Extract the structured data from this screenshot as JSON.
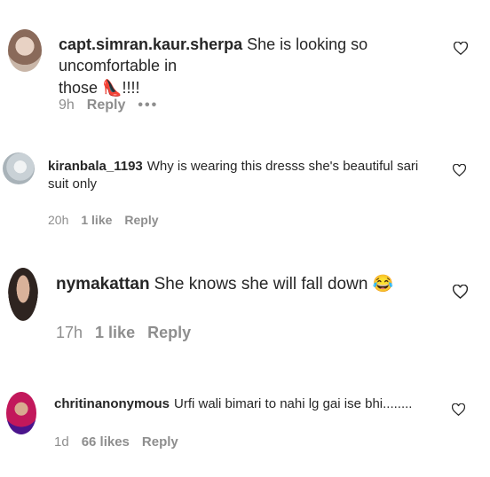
{
  "comments": [
    {
      "username": "capt.simran.kaur.sherpa",
      "text_a": "She is looking so uncomfortable in",
      "text_b": "those",
      "emoji": "👠",
      "text_c": "!!!!",
      "time": "9h",
      "likes": "",
      "reply": "Reply",
      "more": "•••"
    },
    {
      "username": "kiranbala_1193",
      "text_a": "Why is wearing this dresss she's beautiful sari",
      "text_b": "suit only",
      "time": "20h",
      "likes": "1 like",
      "reply": "Reply"
    },
    {
      "username": "nymakattan",
      "text_a": "She knows she will fall down",
      "emoji": "😂",
      "time": "17h",
      "likes": "1 like",
      "reply": "Reply"
    },
    {
      "username": "chritinanonymous",
      "text_a": "Urfi wali bimari to nahi lg gai ise bhi........",
      "time": "1d",
      "likes": "66 likes",
      "reply": "Reply"
    }
  ]
}
